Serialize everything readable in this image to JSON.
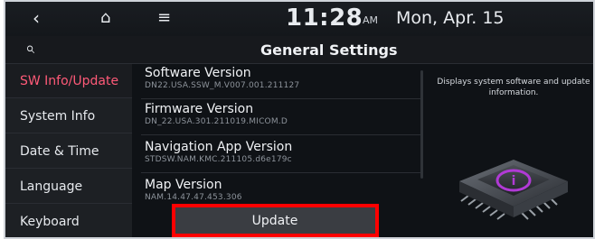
{
  "status": {
    "back_icon": "chevron-left-icon",
    "home_icon": "home-icon",
    "menu_icon": "menu-icon",
    "time": "11:28",
    "ampm": "AM",
    "date": "Mon, Apr. 15"
  },
  "header": {
    "search_icon": "search-icon",
    "title": "General Settings"
  },
  "sidebar": {
    "items": [
      {
        "label": "SW Info/Update",
        "active": true
      },
      {
        "label": "System Info",
        "active": false
      },
      {
        "label": "Date & Time",
        "active": false
      },
      {
        "label": "Language",
        "active": false
      },
      {
        "label": "Keyboard",
        "active": false
      }
    ]
  },
  "main": {
    "rows": [
      {
        "title": "Software Version",
        "value": "DN22.USA.SSW_M.V007.001.211127"
      },
      {
        "title": "Firmware Version",
        "value": "DN_22.USA.301.211019.MICOM.D"
      },
      {
        "title": "Navigation App Version",
        "value": "STDSW.NAM.KMC.211105.d6e179c"
      },
      {
        "title": "Map Version",
        "value": "NAM.14.47.47.453.306"
      }
    ],
    "update_label": "Update"
  },
  "info": {
    "description": "Displays system software and update information."
  },
  "colors": {
    "accent": "#ff5a78",
    "highlight_box": "#ff0000",
    "chip_accent": "#b13ad6"
  }
}
